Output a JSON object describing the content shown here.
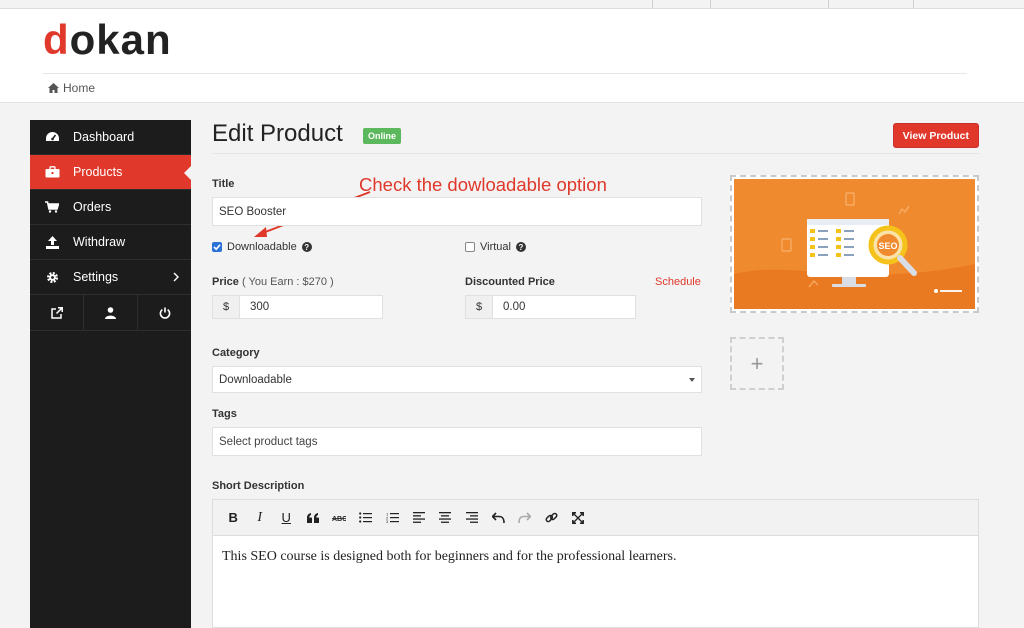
{
  "brand": {
    "logo_first": "d",
    "logo_rest": "okan"
  },
  "breadcrumb": {
    "home": "Home"
  },
  "sidebar": {
    "items": [
      {
        "label": "Dashboard",
        "icon": "dashboard-icon"
      },
      {
        "label": "Products",
        "icon": "briefcase-icon",
        "active": true
      },
      {
        "label": "Orders",
        "icon": "cart-icon"
      },
      {
        "label": "Withdraw",
        "icon": "upload-icon"
      },
      {
        "label": "Settings",
        "icon": "gear-icon"
      }
    ],
    "footer_icons": [
      "external-link-icon",
      "user-icon",
      "power-icon"
    ]
  },
  "header": {
    "title": "Edit Product",
    "status": "Online",
    "view_button": "View Product"
  },
  "annotation": "Check the dowloadable option",
  "form": {
    "title_label": "Title",
    "title_value": "SEO Booster",
    "downloadable_label": "Downloadable",
    "downloadable_checked": true,
    "virtual_label": "Virtual",
    "virtual_checked": false,
    "price_label": "Price",
    "price_sub": "( You Earn : $270 )",
    "currency": "$",
    "price_value": "300",
    "discount_label": "Discounted Price",
    "discount_value": "0.00",
    "schedule_link": "Schedule",
    "category_label": "Category",
    "category_value": "Downloadable",
    "tags_label": "Tags",
    "tags_placeholder": "Select product tags",
    "short_desc_label": "Short Description",
    "short_desc_text": "This SEO course is designed both for beginners and for the professional learners."
  },
  "image": {
    "badge_text": "SEO",
    "add_symbol": "+"
  },
  "colors": {
    "accent": "#e0382a",
    "sidebar": "#1c1c1c",
    "online": "#5cb85c",
    "preview_bg": "#f08a2e"
  }
}
